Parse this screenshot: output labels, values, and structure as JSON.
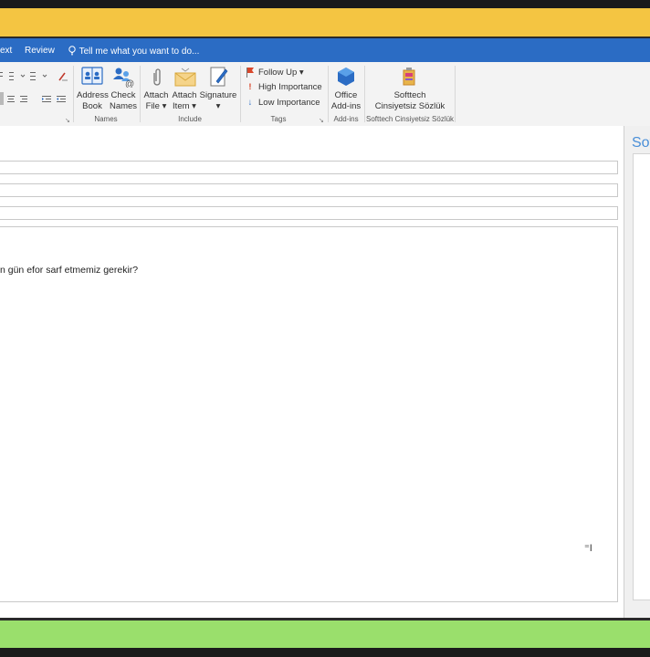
{
  "tabs": {
    "text_partial": "ext",
    "review": "Review",
    "tell_me": "Tell me what you want to do..."
  },
  "ribbon": {
    "names_group": {
      "label": "Names",
      "address_book": [
        "Address",
        "Book"
      ],
      "check_names": [
        "Check",
        "Names"
      ]
    },
    "include_group": {
      "label": "Include",
      "attach_file": [
        "Attach",
        "File ▾"
      ],
      "attach_item": [
        "Attach",
        "Item ▾"
      ],
      "signature": [
        "Signature",
        "▾"
      ]
    },
    "tags_group": {
      "label": "Tags",
      "follow_up": "Follow Up ▾",
      "high_importance": "High Importance",
      "low_importance": "Low Importance"
    },
    "addins_group": {
      "label": "Add-ins",
      "office_addins": [
        "Office",
        "Add-ins"
      ]
    },
    "softtech_group": {
      "label": "Softtech Cinsiyetsiz Sözlük",
      "button": [
        "Softtech",
        "Cinsiyetsiz Sözlük"
      ]
    }
  },
  "message": {
    "body_text": "n gün efor sarf etmemiz gerekir?"
  },
  "side_pane": {
    "title": "Sof"
  },
  "colors": {
    "yellow": "#f4c542",
    "tabbar": "#2b6cc4",
    "green": "#9adf6c"
  }
}
